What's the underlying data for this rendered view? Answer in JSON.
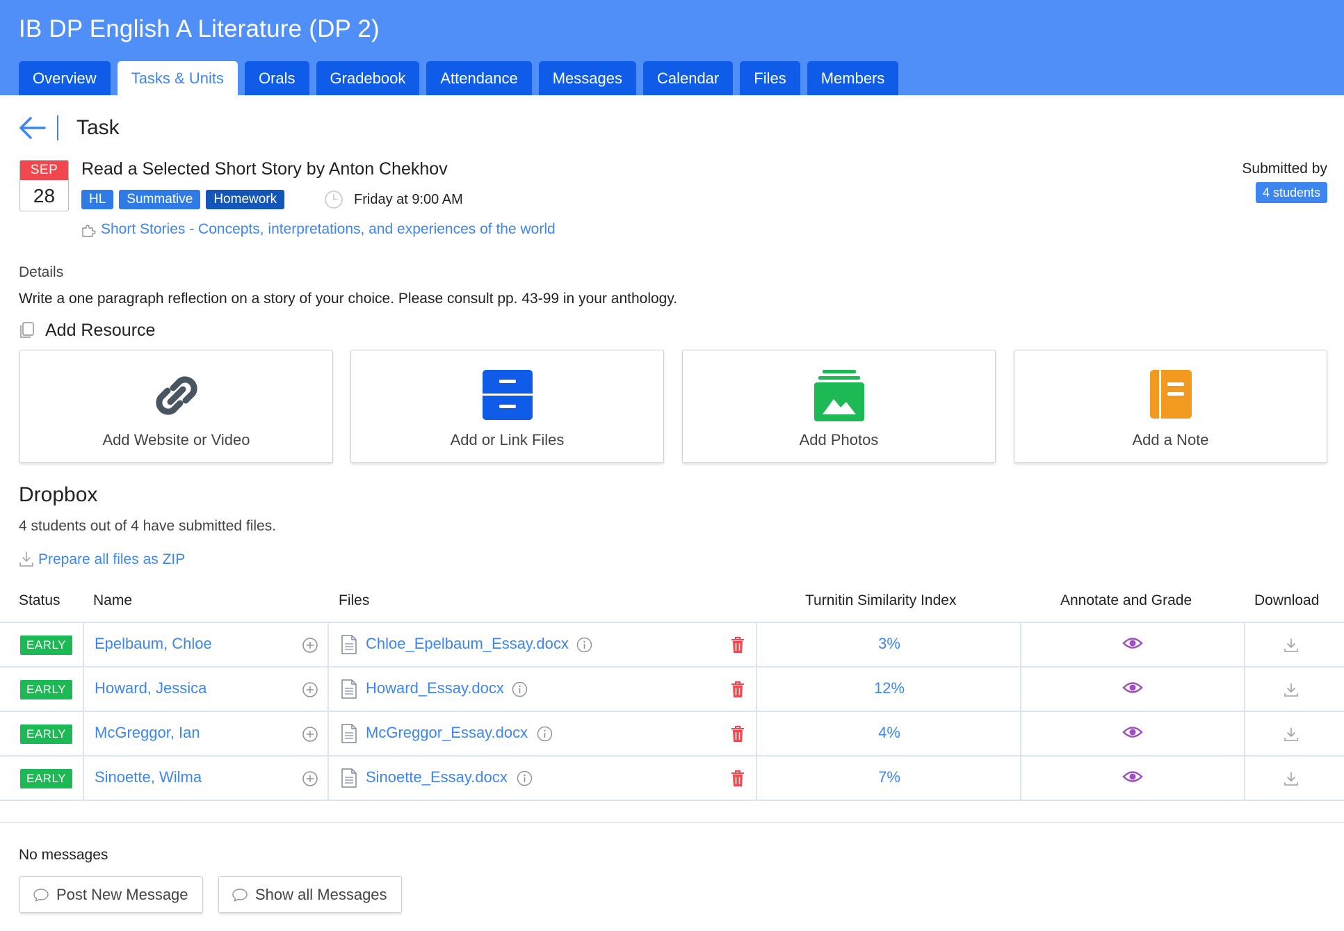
{
  "course": {
    "title": "IB DP English A Literature (DP 2)"
  },
  "tabs": [
    {
      "label": "Overview"
    },
    {
      "label": "Tasks & Units"
    },
    {
      "label": "Orals"
    },
    {
      "label": "Gradebook"
    },
    {
      "label": "Attendance"
    },
    {
      "label": "Messages"
    },
    {
      "label": "Calendar"
    },
    {
      "label": "Files"
    },
    {
      "label": "Members"
    }
  ],
  "active_tab": "Tasks & Units",
  "task": {
    "page_label": "Task",
    "date": {
      "month": "SEP",
      "day": "28"
    },
    "title": "Read a Selected Short Story by Anton Chekhov",
    "badges": {
      "level": "HL",
      "type": "Summative",
      "category": "Homework"
    },
    "due": "Friday at 9:00 AM",
    "unit_link": "Short Stories - Concepts, interpretations, and experiences of the world",
    "submitted_label": "Submitted by",
    "submitted_count": "4 students",
    "details_label": "Details",
    "details_text": "Write a one paragraph reflection on a story of your choice. Please consult pp. 43-99 in your anthology."
  },
  "resources": {
    "heading": "Add Resource",
    "cards": [
      {
        "label": "Add Website or Video",
        "icon": "link-icon",
        "color": "#4a5562"
      },
      {
        "label": "Add or Link Files",
        "icon": "file-cabinet-icon",
        "color": "#0e5ce8"
      },
      {
        "label": "Add Photos",
        "icon": "photos-icon",
        "color": "#1db954"
      },
      {
        "label": "Add a Note",
        "icon": "note-icon",
        "color": "#f29a1f"
      }
    ]
  },
  "dropbox": {
    "title": "Dropbox",
    "summary": "4 students out of 4 have submitted files.",
    "zip_link": "Prepare all files as ZIP",
    "columns": {
      "status": "Status",
      "name": "Name",
      "files": "Files",
      "similarity": "Turnitin Similarity Index",
      "annotate": "Annotate and Grade",
      "download": "Download"
    },
    "rows": [
      {
        "status": "EARLY",
        "name": "Epelbaum, Chloe",
        "file": "Chloe_Epelbaum_Essay.docx",
        "similarity": "3%"
      },
      {
        "status": "EARLY",
        "name": "Howard, Jessica",
        "file": "Howard_Essay.docx",
        "similarity": "12%"
      },
      {
        "status": "EARLY",
        "name": "McGreggor, Ian",
        "file": "McGreggor_Essay.docx",
        "similarity": "4%"
      },
      {
        "status": "EARLY",
        "name": "Sinoette, Wilma",
        "file": "Sinoette_Essay.docx",
        "similarity": "7%"
      }
    ]
  },
  "messages": {
    "empty_text": "No messages",
    "post_button": "Post New Message",
    "show_button": "Show all Messages"
  },
  "colors": {
    "header_bg": "#4f8ff7",
    "tab_bg": "#0e5ce8",
    "link": "#3d86f0",
    "early_badge": "#1db954",
    "trash": "#f2474e",
    "eye": "#a14bc4",
    "month_bar": "#f2474e"
  }
}
